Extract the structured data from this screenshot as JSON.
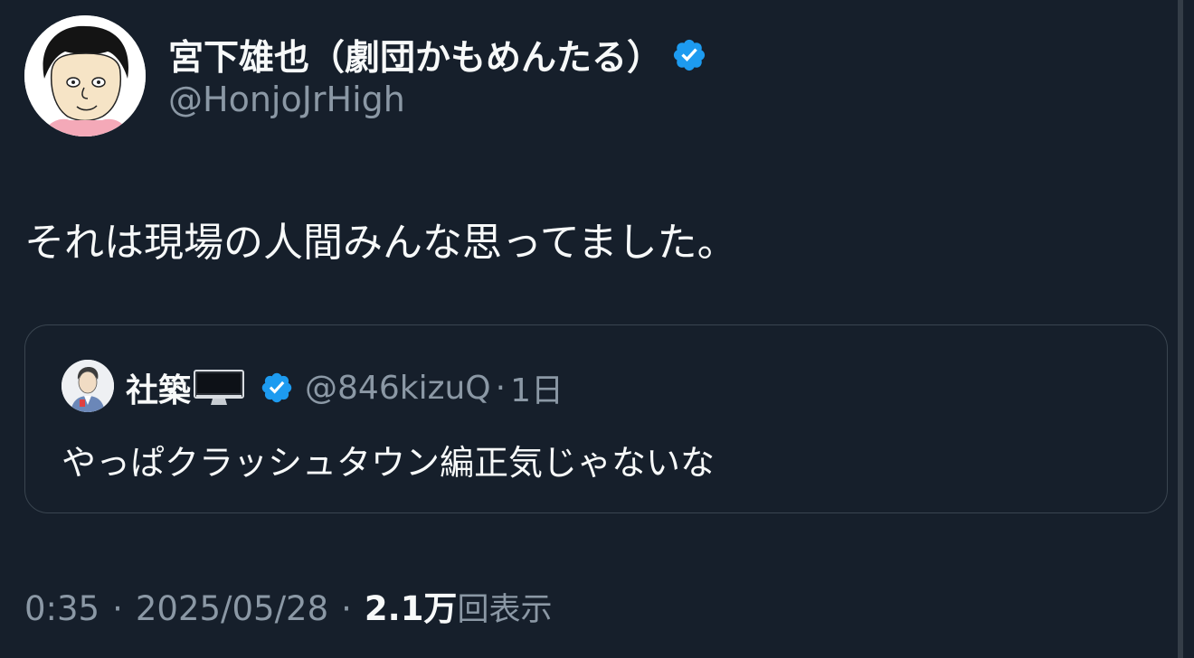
{
  "tweet": {
    "author": {
      "display_name": "宮下雄也（劇団かもめんたる）",
      "handle": "@HonjoJrHigh",
      "verified": true,
      "verified_color": "#1d9bf0"
    },
    "text": "それは現場の人間みんな思ってました。",
    "quoted": {
      "display_name": "社築",
      "name_icon": "desktop-computer-icon",
      "verified": true,
      "handle": "@846kizuQ",
      "separator": "·",
      "time": "1日",
      "text": "やっぱクラッシュタウン編正気じゃないな"
    },
    "meta": {
      "time": "0:35",
      "separator": "·",
      "date": "2025/05/28",
      "views_count": "2.1万",
      "views_label": "回表示"
    }
  },
  "colors": {
    "background": "#15202b",
    "text_primary": "#f7f9f9",
    "text_secondary": "#8b98a5",
    "border": "#3a4550",
    "accent": "#1d9bf0"
  }
}
